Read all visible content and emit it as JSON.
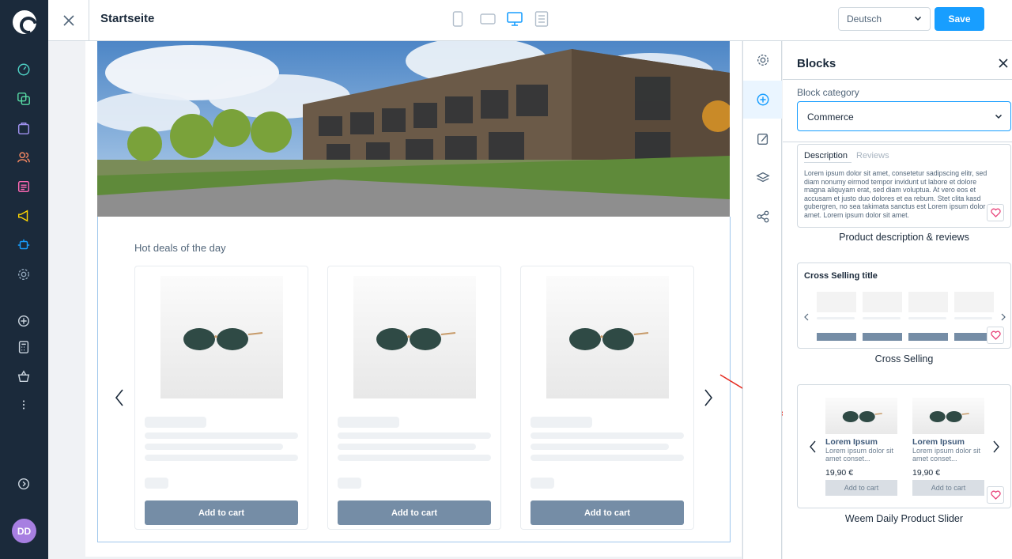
{
  "topbar": {
    "page_title": "Startseite",
    "language": "Deutsch",
    "save_label": "Save"
  },
  "avatar": {
    "initials": "DD"
  },
  "canvas": {
    "section_title": "Hot deals of the day",
    "cards": [
      {
        "button_label": "Add to cart"
      },
      {
        "button_label": "Add to cart"
      },
      {
        "button_label": "Add to cart"
      }
    ]
  },
  "blocks_panel": {
    "title": "Blocks",
    "category_label": "Block category",
    "category_value": "Commerce",
    "blocks": [
      {
        "name": "Product description & reviews",
        "tabs": [
          "Description",
          "Reviews"
        ],
        "text": "Lorem ipsum dolor sit amet, consetetur sadipscing elitr, sed diam nonumy eirmod tempor invidunt ut labore et dolore magna aliquyam erat, sed diam voluptua. At vero eos et accusam et justo duo dolores et ea rebum. Stet clita kasd gubergren, no sea takimata sanctus est Lorem ipsum dolor sit amet. Lorem ipsum dolor sit amet."
      },
      {
        "name": "Cross Selling",
        "preview_title": "Cross Selling title"
      },
      {
        "name": "Weem Daily Product Slider",
        "products": [
          {
            "title": "Lorem Ipsum",
            "desc": "Lorem ipsum dolor sit amet conset...",
            "price": "19,90 €",
            "button": "Add to cart"
          },
          {
            "title": "Lorem Ipsum",
            "desc": "Lorem ipsum dolor sit amet conset...",
            "price": "19,90 €",
            "button": "Add to cart"
          }
        ]
      }
    ]
  },
  "colors": {
    "sidebar": "#1b2a3b",
    "accent": "#189eff",
    "button_gray": "#758da6",
    "annotation_arrow": "#e52b20"
  }
}
